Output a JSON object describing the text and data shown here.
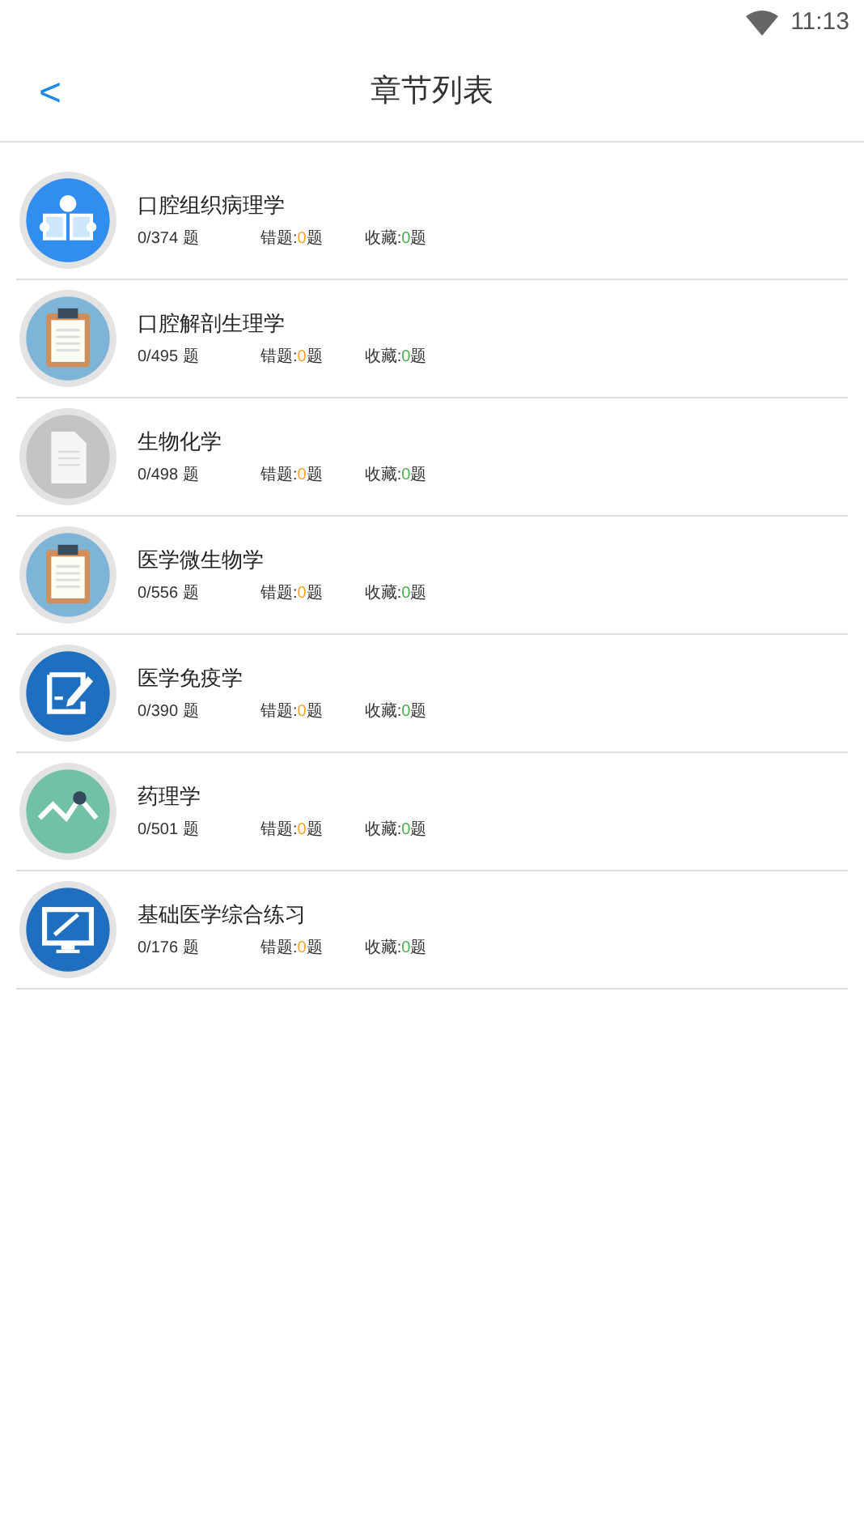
{
  "status_bar": {
    "time": "11:13"
  },
  "header": {
    "back": "<",
    "title": "章节列表"
  },
  "chapters": [
    {
      "kind": "book",
      "title": "口腔组织病理学",
      "progress": "0/374 题",
      "wrong_label": "错题:",
      "wrong_count": "0",
      "wrong_unit": "题",
      "fav_label": "收藏:",
      "fav_count": "0",
      "fav_unit": "题"
    },
    {
      "kind": "clipboard",
      "title": "口腔解剖生理学",
      "progress": "0/495 题",
      "wrong_label": "错题:",
      "wrong_count": "0",
      "wrong_unit": "题",
      "fav_label": "收藏:",
      "fav_count": "0",
      "fav_unit": "题"
    },
    {
      "kind": "document",
      "title": "生物化学",
      "progress": "0/498 题",
      "wrong_label": "错题:",
      "wrong_count": "0",
      "wrong_unit": "题",
      "fav_label": "收藏:",
      "fav_count": "0",
      "fav_unit": "题"
    },
    {
      "kind": "clipboard",
      "title": "医学微生物学",
      "progress": "0/556 题",
      "wrong_label": "错题:",
      "wrong_count": "0",
      "wrong_unit": "题",
      "fav_label": "收藏:",
      "fav_count": "0",
      "fav_unit": "题"
    },
    {
      "kind": "pen",
      "title": "医学免疫学",
      "progress": "0/390 题",
      "wrong_label": "错题:",
      "wrong_count": "0",
      "wrong_unit": "题",
      "fav_label": "收藏:",
      "fav_count": "0",
      "fav_unit": "题"
    },
    {
      "kind": "chart",
      "title": "药理学",
      "progress": "0/501 题",
      "wrong_label": "错题:",
      "wrong_count": "0",
      "wrong_unit": "题",
      "fav_label": "收藏:",
      "fav_count": "0",
      "fav_unit": "题"
    },
    {
      "kind": "monitor",
      "title": "基础医学综合练习",
      "progress": "0/176 题",
      "wrong_label": "错题:",
      "wrong_count": "0",
      "wrong_unit": "题",
      "fav_label": "收藏:",
      "fav_count": "0",
      "fav_unit": "题"
    }
  ]
}
